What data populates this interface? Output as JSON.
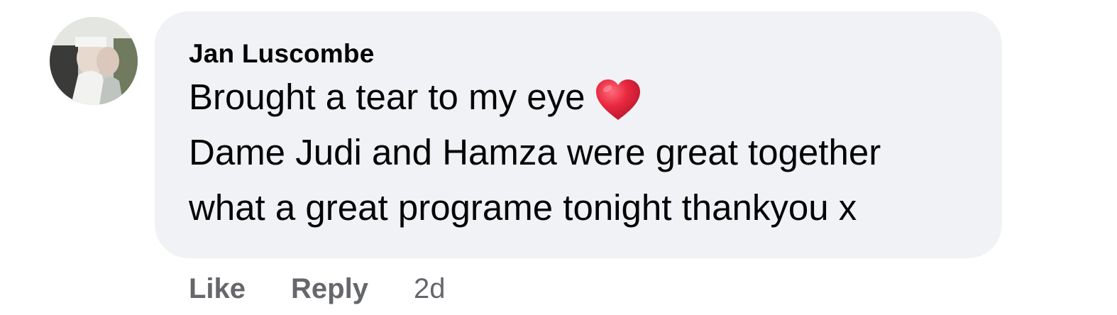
{
  "comment": {
    "author": "Jan Luscombe",
    "lines": [
      "Brought a tear to my eye",
      "Dame Judi and Hamza were great together",
      "what a great programe tonight thankyou x"
    ],
    "emoji": "red-heart-icon",
    "heart_color": "#e0203a"
  },
  "actions": {
    "like_label": "Like",
    "reply_label": "Reply",
    "timestamp": "2d"
  },
  "colors": {
    "bubble_background": "#f0f2f5",
    "text_primary": "#050505",
    "text_secondary": "#65676b"
  }
}
